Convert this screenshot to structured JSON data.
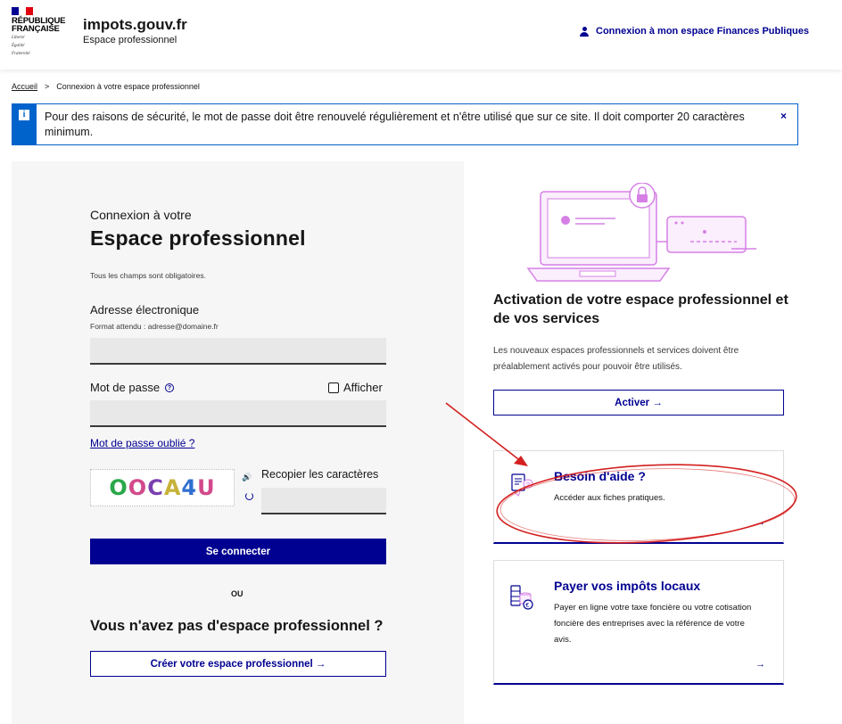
{
  "header": {
    "republic_line1": "RÉPUBLIQUE",
    "republic_line2": "FRANÇAISE",
    "motto_line1": "Liberté",
    "motto_line2": "Égalité",
    "motto_line3": "Fraternité",
    "site_title": "impots.gouv.fr",
    "site_subtitle": "Espace professionnel",
    "login_link": "Connexion à mon espace Finances Publiques"
  },
  "breadcrumb": {
    "home": "Accueil",
    "separator": ">",
    "current": "Connexion à votre espace professionnel"
  },
  "alert": {
    "icon": "i",
    "text": "Pour des raisons de sécurité, le mot de passe doit être renouvelé régulièrement et n'être utilisé que sur ce site. Il doit comporter 20 caractères minimum.",
    "close": "×"
  },
  "login": {
    "subtitle": "Connexion à votre",
    "title": "Espace professionnel",
    "required_note": "Tous les champs sont obligatoires.",
    "email_label": "Adresse électronique",
    "email_hint": "Format attendu : adresse@domaine.fr",
    "email_value": "",
    "password_label": "Mot de passe",
    "password_help_icon": "?",
    "password_value": "",
    "show_password_label": "Afficher",
    "show_password_checked": false,
    "forgot_password": "Mot de passe oublié ?",
    "captcha_text": [
      "O",
      "O",
      "C",
      "A",
      "4",
      "U"
    ],
    "captcha_label": "Recopier les caractères",
    "captcha_audio_icon": "🔊",
    "captcha_value": "",
    "submit_label": "Se connecter",
    "or_label": "OU",
    "no_account_title": "Vous n'avez pas d'espace professionnel ?",
    "create_label": "Créer votre espace professionnel  →"
  },
  "activation": {
    "title": "Activation de votre espace professionnel et de vos services",
    "text": "Les nouveaux espaces professionnels et services doivent être préalablement activés pour pouvoir être utilisés.",
    "button_label": "Activer  →"
  },
  "cards": {
    "help": {
      "title": "Besoin d'aide ?",
      "text": "Accéder aux fiches pratiques.",
      "arrow": "→"
    },
    "pay": {
      "title": "Payer vos impôts locaux",
      "text": "Payer en ligne votre taxe foncière ou votre cotisation foncière des entreprises avec la référence de votre avis.",
      "arrow": "→"
    }
  },
  "colors": {
    "primary": "#000091",
    "alert_blue": "#0063cb",
    "annotation_red": "#d42020",
    "illustration_pink": "#d680e6"
  }
}
